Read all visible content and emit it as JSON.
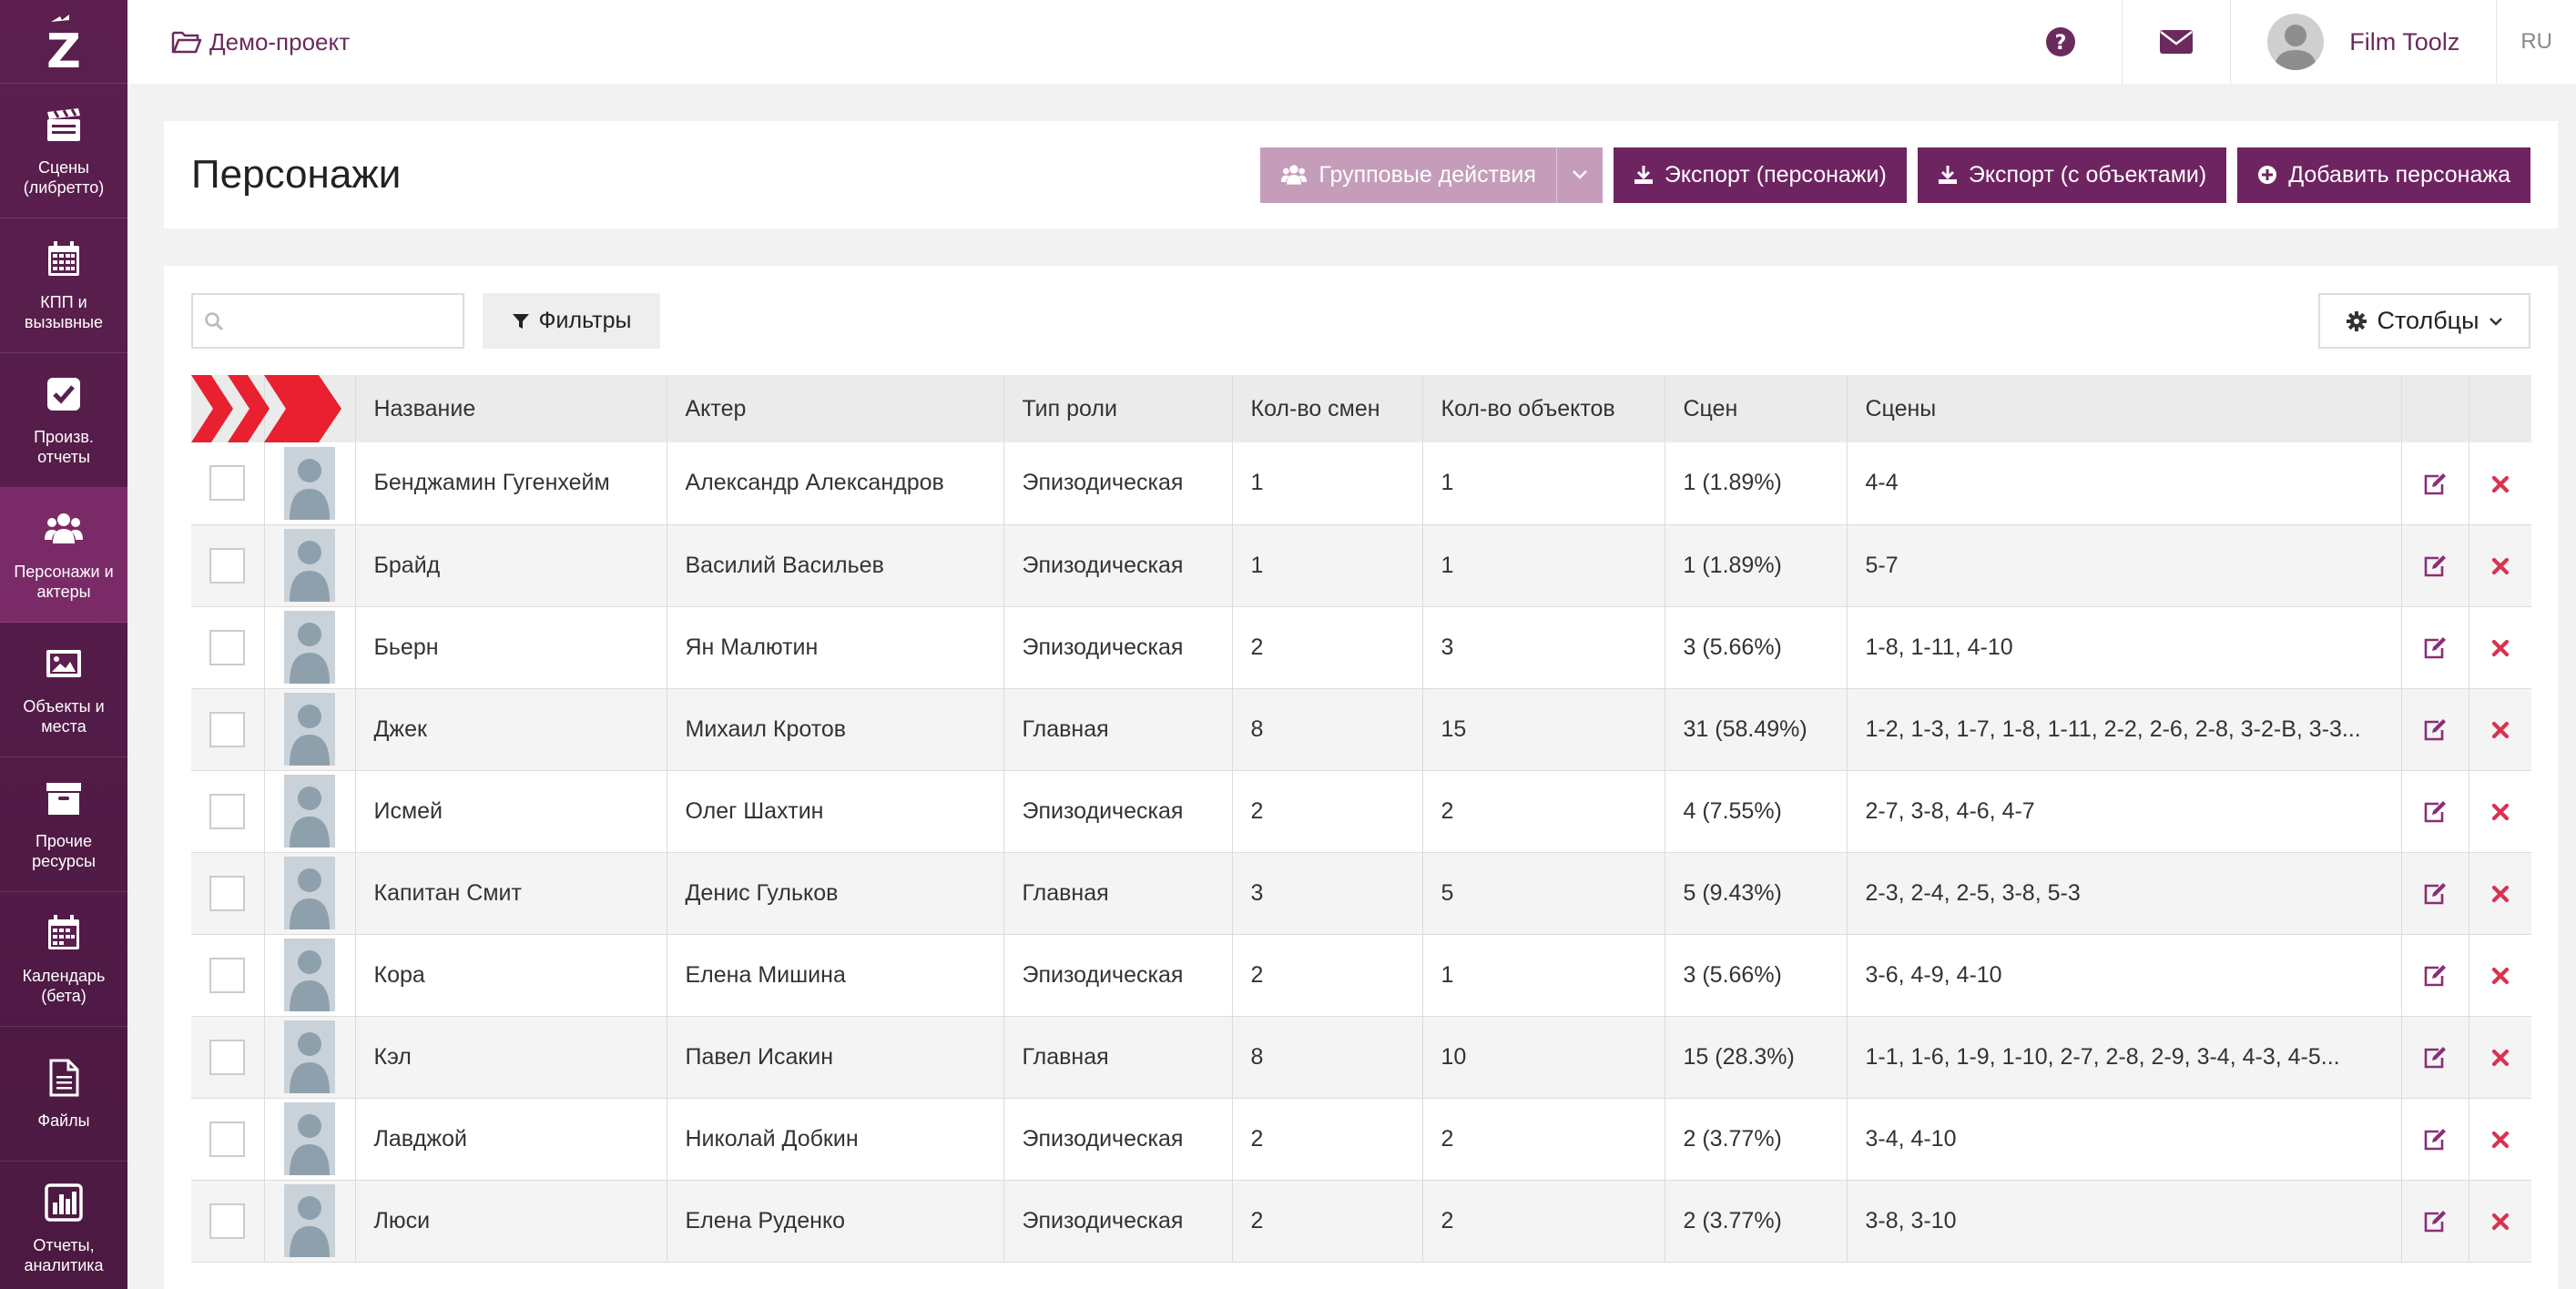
{
  "brand": {
    "logo_letter": "Z"
  },
  "sidebar": {
    "items": [
      {
        "label": "Сцены (либретто)",
        "icon": "clapperboard-icon"
      },
      {
        "label": "КПП и вызывные",
        "icon": "calendar-grid-icon"
      },
      {
        "label": "Произв. отчеты",
        "icon": "checkbox-icon"
      },
      {
        "label": "Персонажи и актеры",
        "icon": "users-icon",
        "active": true
      },
      {
        "label": "Объекты и места",
        "icon": "image-icon"
      },
      {
        "label": "Прочие ресурсы",
        "icon": "archive-box-icon"
      },
      {
        "label": "Календарь (бета)",
        "icon": "calendar-icon"
      },
      {
        "label": "Файлы",
        "icon": "file-icon"
      },
      {
        "label": "Отчеты, аналитика",
        "icon": "bar-chart-icon"
      }
    ]
  },
  "topbar": {
    "project": "Демо-проект",
    "user": "Film Toolz",
    "lang": "RU"
  },
  "header": {
    "title": "Персонажи",
    "group_actions": "Групповые действия",
    "export_characters": "Экспорт (персонажи)",
    "export_objects": "Экспорт (с объектами)",
    "add_character": "Добавить персонажа"
  },
  "toolbar": {
    "search_value": "",
    "filters": "Фильтры",
    "columns": "Столбцы"
  },
  "table": {
    "headers": [
      "Название",
      "Актер",
      "Тип роли",
      "Кол-во смен",
      "Кол-во объектов",
      "Сцен",
      "Сцены"
    ],
    "rows": [
      [
        "Бенджамин Гугенхейм",
        "Александр Александров",
        "Эпизодическая",
        "1",
        "1",
        "1 (1.89%)",
        "4-4"
      ],
      [
        "Брайд",
        "Василий Васильев",
        "Эпизодическая",
        "1",
        "1",
        "1 (1.89%)",
        "5-7"
      ],
      [
        "Бьерн",
        "Ян Малютин",
        "Эпизодическая",
        "2",
        "3",
        "3 (5.66%)",
        "1-8, 1-11, 4-10"
      ],
      [
        "Джек",
        "Михаил Кротов",
        "Главная",
        "8",
        "15",
        "31 (58.49%)",
        "1-2, 1-3, 1-7, 1-8, 1-11, 2-2, 2-6, 2-8, 3-2-В, 3-3..."
      ],
      [
        "Исмей",
        "Олег Шахтин",
        "Эпизодическая",
        "2",
        "2",
        "4 (7.55%)",
        "2-7, 3-8, 4-6, 4-7"
      ],
      [
        "Капитан Смит",
        "Денис Гульков",
        "Главная",
        "3",
        "5",
        "5 (9.43%)",
        "2-3, 2-4, 2-5, 3-8, 5-3"
      ],
      [
        "Кора",
        "Елена Мишина",
        "Эпизодическая",
        "2",
        "1",
        "3 (5.66%)",
        "3-6, 4-9, 4-10"
      ],
      [
        "Кэл",
        "Павел Исакин",
        "Главная",
        "8",
        "10",
        "15 (28.3%)",
        "1-1, 1-6, 1-9, 1-10, 2-7, 2-8, 2-9, 3-4, 4-3, 4-5..."
      ],
      [
        "Лавджой",
        "Николай Добкин",
        "Эпизодическая",
        "2",
        "2",
        "2 (3.77%)",
        "3-4, 4-10"
      ],
      [
        "Люси",
        "Елена Руденко",
        "Эпизодическая",
        "2",
        "2",
        "2 (3.77%)",
        "3-8, 3-10"
      ]
    ]
  },
  "colors": {
    "brand": "#5c1f4f",
    "button": "#6f2462",
    "button_disabled": "#c59dbb",
    "delete": "#d9334f",
    "ribbon": "#e8202f"
  }
}
